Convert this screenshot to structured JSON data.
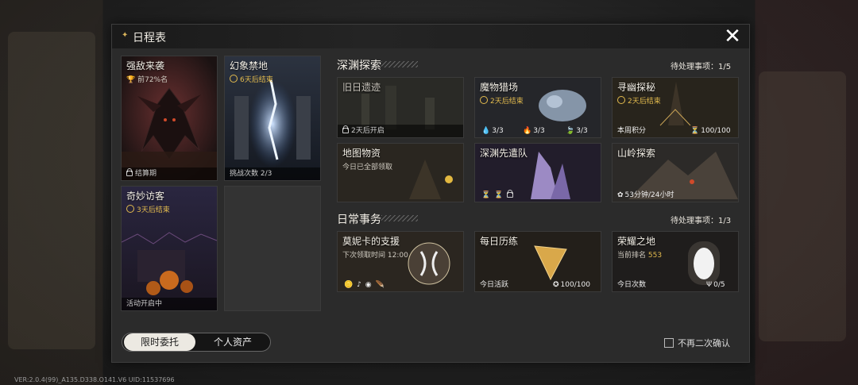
{
  "version_text": "VER:2.0.4(99)_A135.D338.O141.V6   UID:11537696",
  "panel": {
    "title": "日程表",
    "close_label": "✕"
  },
  "limited": {
    "cards": [
      {
        "title": "强敌来袭",
        "sub": "前72%名",
        "foot": "结算期"
      },
      {
        "title": "幻象禁地",
        "sub": "6天后结束",
        "foot": "挑战次数 2/3"
      },
      {
        "title": "奇妙访客",
        "sub": "3天后结束",
        "foot": "活动开启中"
      }
    ]
  },
  "abyss": {
    "title": "深渊探索",
    "pending": "待处理事项：1/5",
    "cards": [
      {
        "title": "旧日遗迹",
        "foot": "2天后开启"
      },
      {
        "title": "魔物猎场",
        "sub": "2天后结束",
        "stats": [
          "3/3",
          "3/3",
          "3/3"
        ]
      },
      {
        "title": "寻幽探秘",
        "sub": "2天后结束",
        "foot_left": "本周积分",
        "foot_right": "100/100"
      },
      {
        "title": "地图物资",
        "sub": "今日已全部领取"
      },
      {
        "title": "深渊先遣队"
      },
      {
        "title": "山岭探索",
        "foot": "53分钟/24小时"
      }
    ]
  },
  "daily": {
    "title": "日常事务",
    "pending": "待处理事项：1/3",
    "cards": [
      {
        "title": "莫妮卡的支援",
        "sub": "下次领取时间 12:00"
      },
      {
        "title": "每日历练",
        "foot_left": "今日活跃",
        "foot_right": "100/100"
      },
      {
        "title": "荣耀之地",
        "sub_label": "当前排名",
        "sub_value": "553",
        "foot_left": "今日次数",
        "foot_right": "0/5"
      }
    ]
  },
  "tabs": [
    "限时委托",
    "个人资产"
  ],
  "dont_confirm_label": "不再二次确认"
}
